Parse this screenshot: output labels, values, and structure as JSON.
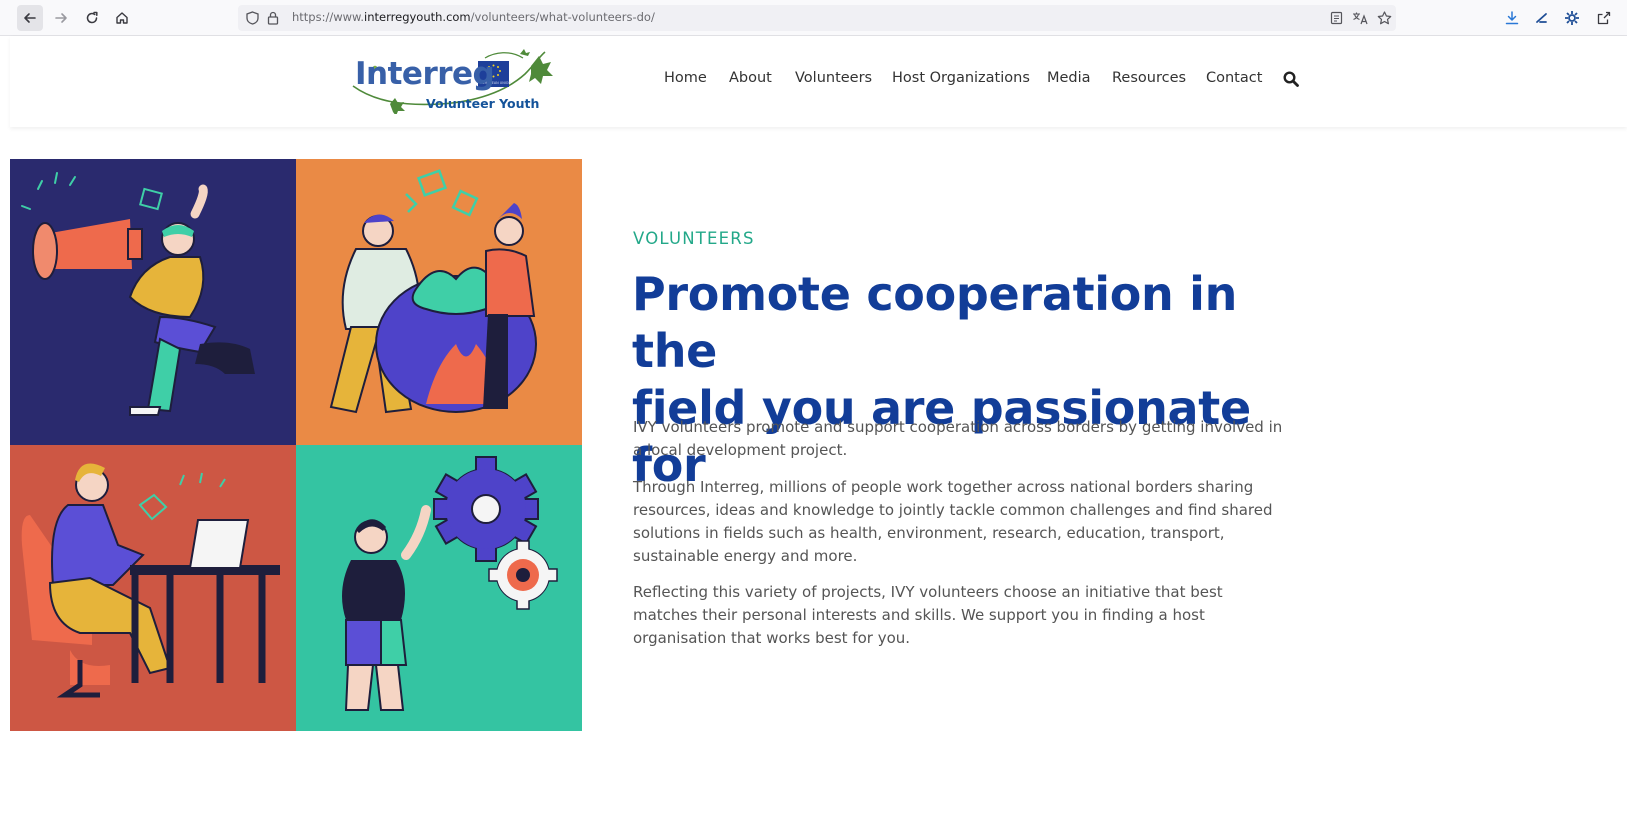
{
  "browser": {
    "url_prefix": "https://www.",
    "url_domain": "interregyouth.com",
    "url_path": "/volunteers/what-volunteers-do/"
  },
  "site": {
    "logo_word": "Interreg",
    "logo_subtitle": "Volunteer Youth",
    "nav": [
      "Home",
      "About",
      "Volunteers",
      "Host Organizations",
      "Media",
      "Resources",
      "Contact"
    ]
  },
  "main": {
    "eyebrow": "VOLUNTEERS",
    "headline_line1": "Promote cooperation in the",
    "headline_line2": "field you are passionate for",
    "paragraphs": [
      "IVY volunteers promote and support cooperation across borders by getting involved in a local development project.",
      "Through Interreg, millions of people work together across national borders sharing resources, ideas and knowledge to jointly tackle common challenges and find shared solutions in fields such as health, environment, research, education, transport, sustainable energy and more.",
      "Reflecting this variety of projects, IVY volunteers choose an initiative that best matches their personal interests and skills. We support you in finding a host organisation that works best for you."
    ]
  },
  "colors": {
    "navy_tile": "#2a2a6e",
    "orange_tile": "#ea8a45",
    "red_tile": "#cd5744",
    "teal_tile": "#34c4a2",
    "headline": "#123d98",
    "eyebrow": "#23a889"
  },
  "icons": [
    "back-arrow-icon",
    "forward-arrow-icon",
    "reload-icon",
    "home-icon",
    "shield-icon",
    "lock-icon",
    "reader-view-icon",
    "translate-icon",
    "bookmark-star-icon",
    "download-icon",
    "extension-icon",
    "settings-gear-icon",
    "share-icon",
    "search-icon"
  ]
}
